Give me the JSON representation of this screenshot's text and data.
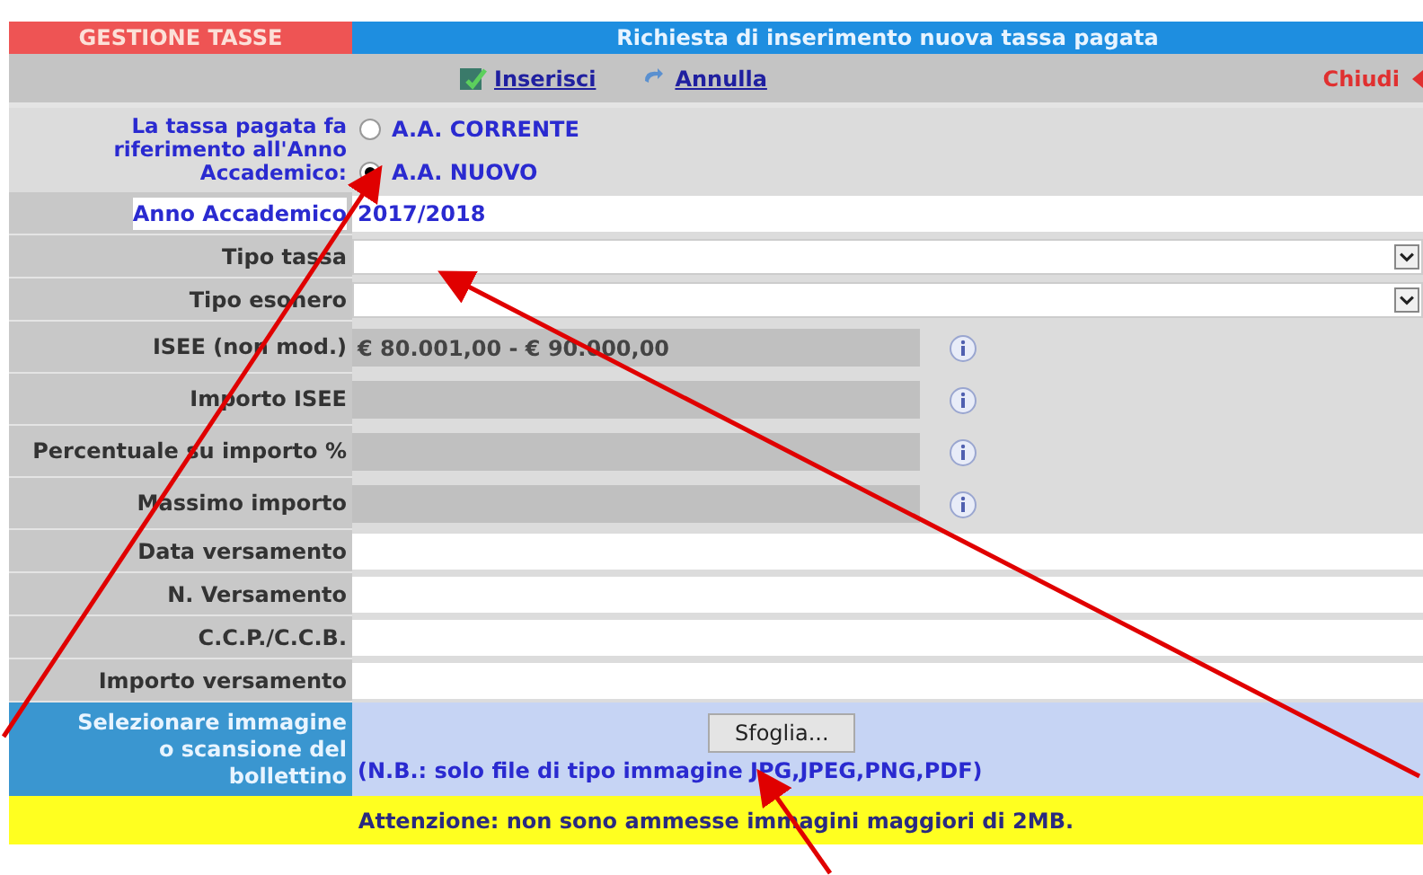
{
  "header": {
    "section": "GESTIONE TASSE",
    "title": "Richiesta di inserimento nuova tassa pagata"
  },
  "toolbar": {
    "insert": "Inserisci",
    "cancel": "Annulla",
    "close": "Chiudi"
  },
  "year_choice": {
    "label": "La tassa pagata fa riferimento all'Anno Accademico:",
    "options": [
      {
        "label": "A.A. CORRENTE",
        "selected": false
      },
      {
        "label": "A.A. NUOVO",
        "selected": true
      }
    ]
  },
  "fields": [
    {
      "kind": "highlight",
      "label": "Anno Accademico",
      "value": "2017/2018"
    },
    {
      "kind": "select",
      "label": "Tipo tassa"
    },
    {
      "kind": "select",
      "label": "Tipo esonero"
    },
    {
      "kind": "readonly",
      "label": "ISEE (non mod.)",
      "value": "€ 80.001,00 - € 90.000,00"
    },
    {
      "kind": "readonly",
      "label": "Importo ISEE"
    },
    {
      "kind": "readonly",
      "label": "Percentuale su importo %"
    },
    {
      "kind": "readonly",
      "label": "Massimo importo"
    },
    {
      "kind": "text",
      "label": "Data versamento"
    },
    {
      "kind": "text",
      "label": "N. Versamento"
    },
    {
      "kind": "text",
      "label": "C.C.P./C.C.B."
    },
    {
      "kind": "text",
      "label": "Importo versamento"
    }
  ],
  "upload": {
    "label": "Selezionare immagine o scansione del bollettino",
    "button": "Sfoglia...",
    "note": "(N.B.: solo file di tipo immagine JPG,JPEG,PNG,PDF)"
  },
  "warning": "Attenzione: non sono ammesse immagini maggiori di 2MB."
}
